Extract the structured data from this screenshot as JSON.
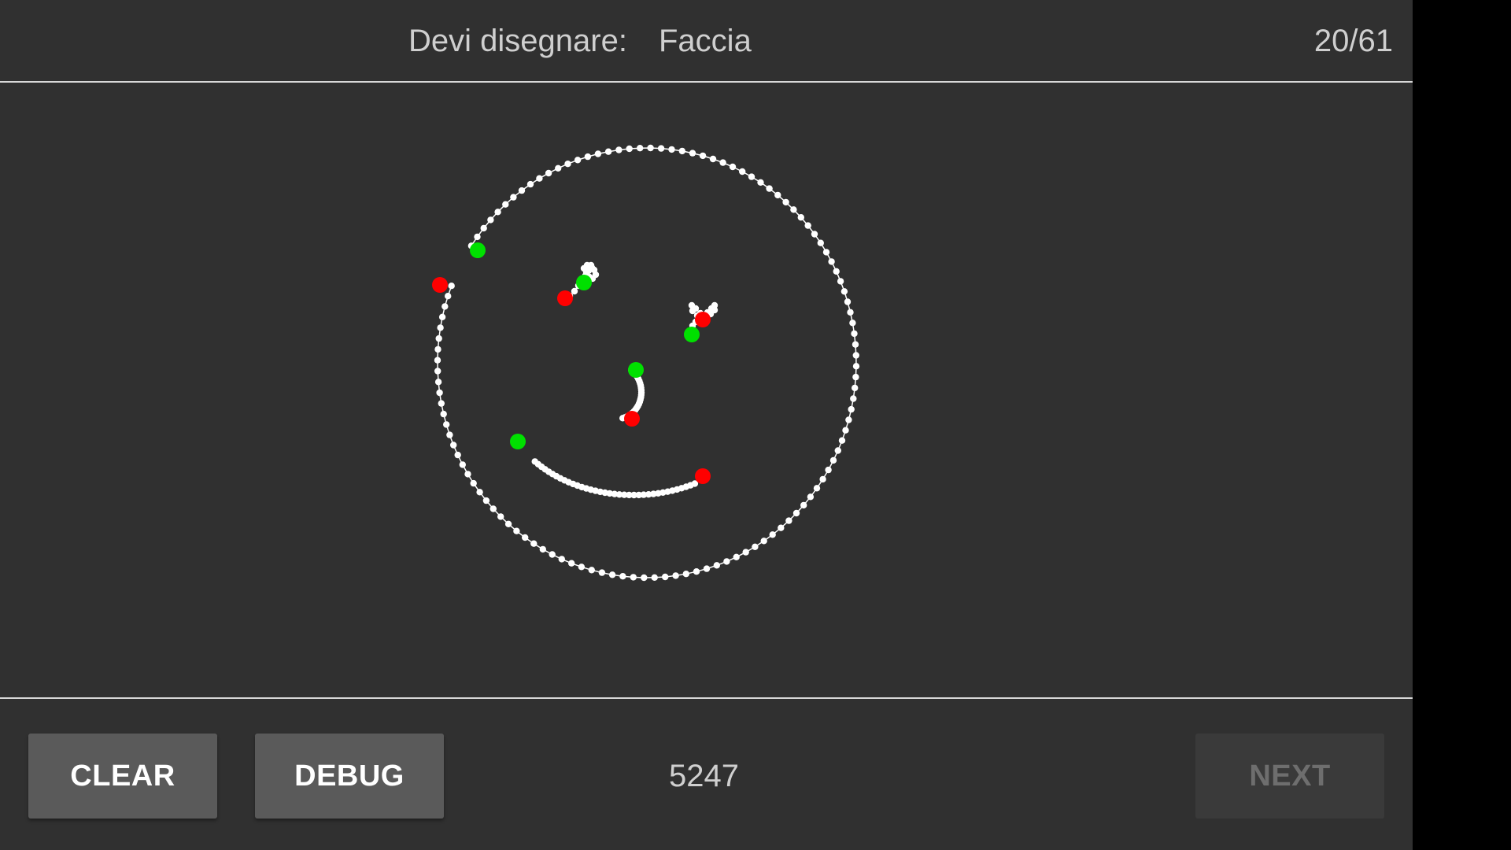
{
  "header": {
    "prompt_label": "Devi disegnare:",
    "prompt_word": "Faccia",
    "progress": "20/61"
  },
  "footer": {
    "clear_label": "CLEAR",
    "debug_label": "DEBUG",
    "score": "5247",
    "next_label": "NEXT"
  },
  "colors": {
    "background": "#303030",
    "stroke_dots": "#ffffff",
    "stroke_start": "#00e000",
    "stroke_end": "#ff0000",
    "button": "#5a5a5a",
    "button_disabled": "#3a3a3a"
  }
}
